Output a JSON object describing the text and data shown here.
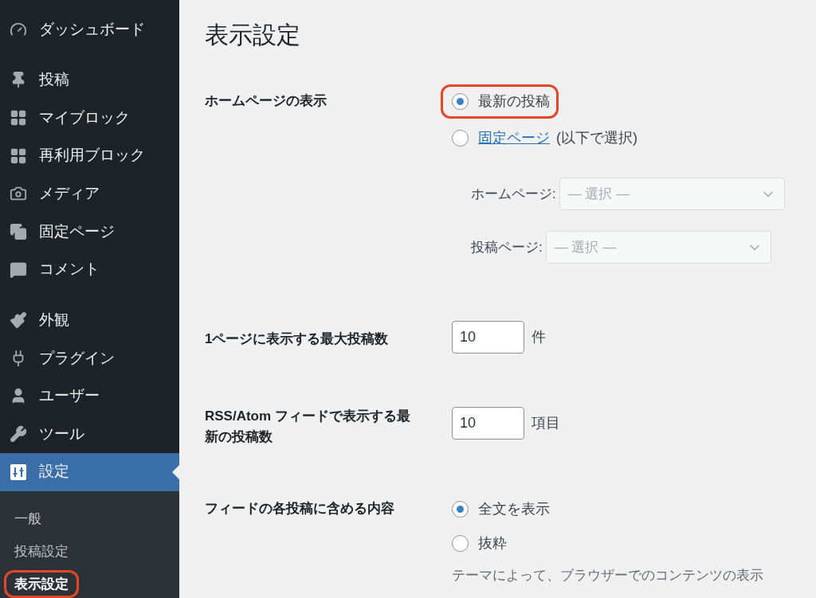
{
  "sidebar": {
    "menu": [
      {
        "label": "ダッシュボード",
        "selected": false,
        "gap_after": true
      },
      {
        "label": "投稿",
        "selected": false,
        "gap_after": false
      },
      {
        "label": "マイブロック",
        "selected": false,
        "gap_after": false
      },
      {
        "label": "再利用ブロック",
        "selected": false,
        "gap_after": false
      },
      {
        "label": "メディア",
        "selected": false,
        "gap_after": false
      },
      {
        "label": "固定ページ",
        "selected": false,
        "gap_after": false
      },
      {
        "label": "コメント",
        "selected": false,
        "gap_after": true
      },
      {
        "label": "外観",
        "selected": false,
        "gap_after": false
      },
      {
        "label": "プラグイン",
        "selected": false,
        "gap_after": false
      },
      {
        "label": "ユーザー",
        "selected": false,
        "gap_after": false
      },
      {
        "label": "ツール",
        "selected": false,
        "gap_after": false
      },
      {
        "label": "設定",
        "selected": true,
        "gap_after": false
      }
    ],
    "submenu": [
      {
        "label": "一般",
        "selected": false,
        "highlighted": false
      },
      {
        "label": "投稿設定",
        "selected": false,
        "highlighted": false
      },
      {
        "label": "表示設定",
        "selected": true,
        "highlighted": true
      }
    ]
  },
  "page_title": "表示設定",
  "settings": [
    {
      "kind": "front_page",
      "label": "ホームページの表示",
      "options": [
        {
          "label": "最新の投稿",
          "selected": true,
          "highlighted": true
        },
        {
          "link": "固定ページ",
          "suffix": "(以下で選択)",
          "selected": false,
          "highlighted": false
        }
      ],
      "selects": [
        {
          "label": "ホームページ:",
          "placeholder": "— 選択 —"
        },
        {
          "label": "投稿ページ:",
          "placeholder": "— 選択 —"
        }
      ]
    },
    {
      "kind": "number",
      "label": "1ページに表示する最大投稿数",
      "value": "10",
      "unit": "件"
    },
    {
      "kind": "number",
      "label": "RSS/Atom フィードで表示する最新の投稿数",
      "value": "10",
      "unit": "項目"
    },
    {
      "kind": "radios",
      "label": "フィードの各投稿に含める内容",
      "options": [
        {
          "label": "全文を表示",
          "selected": true,
          "highlighted": false
        },
        {
          "label": "抜粋",
          "selected": false,
          "highlighted": false
        }
      ],
      "description": "テーマによって、ブラウザーでのコンテンツの表示"
    }
  ]
}
